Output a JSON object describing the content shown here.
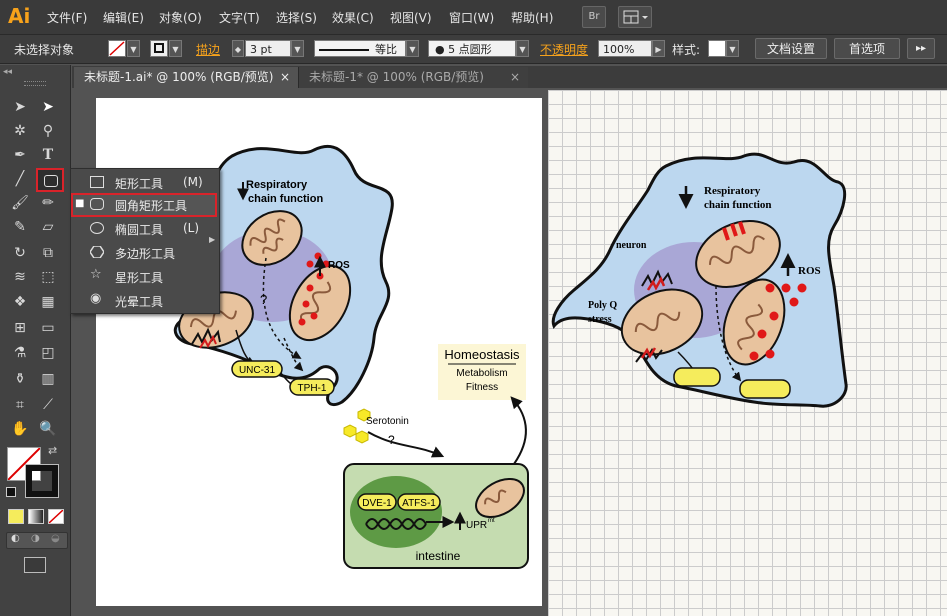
{
  "app": {
    "logo": "Ai"
  },
  "menu": [
    "文件(F)",
    "编辑(E)",
    "对象(O)",
    "文字(T)",
    "选择(S)",
    "效果(C)",
    "视图(V)",
    "窗口(W)",
    "帮助(H)"
  ],
  "bridge_button": "Br",
  "control": {
    "selection_status": "未选择对象",
    "stroke_label": "描边",
    "stroke_weight": "3 pt",
    "stroke_profile": "等比",
    "brush": "5 点圆形",
    "opacity_label": "不透明度",
    "opacity_value": "100%",
    "style_label": "样式:",
    "doc_setup": "文档设置",
    "preferences": "首选项"
  },
  "tabs": [
    {
      "label": "未标题-1.ai* @ 100% (RGB/预览)",
      "close": "×",
      "active": true
    },
    {
      "label": "未标题-1* @ 100% (RGB/预览)",
      "close": "×",
      "active": false
    }
  ],
  "flyout": {
    "items": [
      {
        "label": "矩形工具",
        "shortcut": "(M)",
        "icon": "rectangle-icon",
        "selected": false
      },
      {
        "label": "圆角矩形工具",
        "shortcut": "",
        "icon": "rounded-rectangle-icon",
        "selected": true
      },
      {
        "label": "椭圆工具",
        "shortcut": "(L)",
        "icon": "ellipse-icon",
        "selected": false
      },
      {
        "label": "多边形工具",
        "shortcut": "",
        "icon": "polygon-icon",
        "selected": false
      },
      {
        "label": "星形工具",
        "shortcut": "",
        "icon": "star-icon",
        "selected": false
      },
      {
        "label": "光晕工具",
        "shortcut": "",
        "icon": "flare-icon",
        "selected": false
      }
    ],
    "highlight_color": "#d9232a"
  },
  "figure_left": {
    "respiratory": [
      "Respiratory",
      "chain function"
    ],
    "ros": "ROS",
    "question": "?",
    "unc31": "UNC-31",
    "tph1": "TPH-1",
    "serotonin": "Serotonin",
    "serotonin_q": "?",
    "homeostasis_title": "Homeostasis",
    "homeostasis_lines": [
      "Metabolism",
      "Fitness"
    ],
    "dve1": "DVE-1",
    "atfs1": "ATFS-1",
    "upr": "UPR",
    "upr_sup": "mt",
    "intestine": "intestine"
  },
  "figure_right": {
    "respiratory": [
      "Respiratory",
      "chain function"
    ],
    "neuron": "neuron",
    "polyq": [
      "Poly Q",
      "stress"
    ],
    "ros": "ROS"
  },
  "colors": {
    "cell_fill": "#bcd7ef",
    "neuron_purple": "#a9a7d6",
    "mito_fill": "#e8c39e",
    "ros_red": "#e01818",
    "yellow_box": "#f5ec5c",
    "intestine_fill": "#c5dcb0",
    "homeostasis_fill": "#fcf6d5",
    "ai_orange": "#f7a21b"
  }
}
